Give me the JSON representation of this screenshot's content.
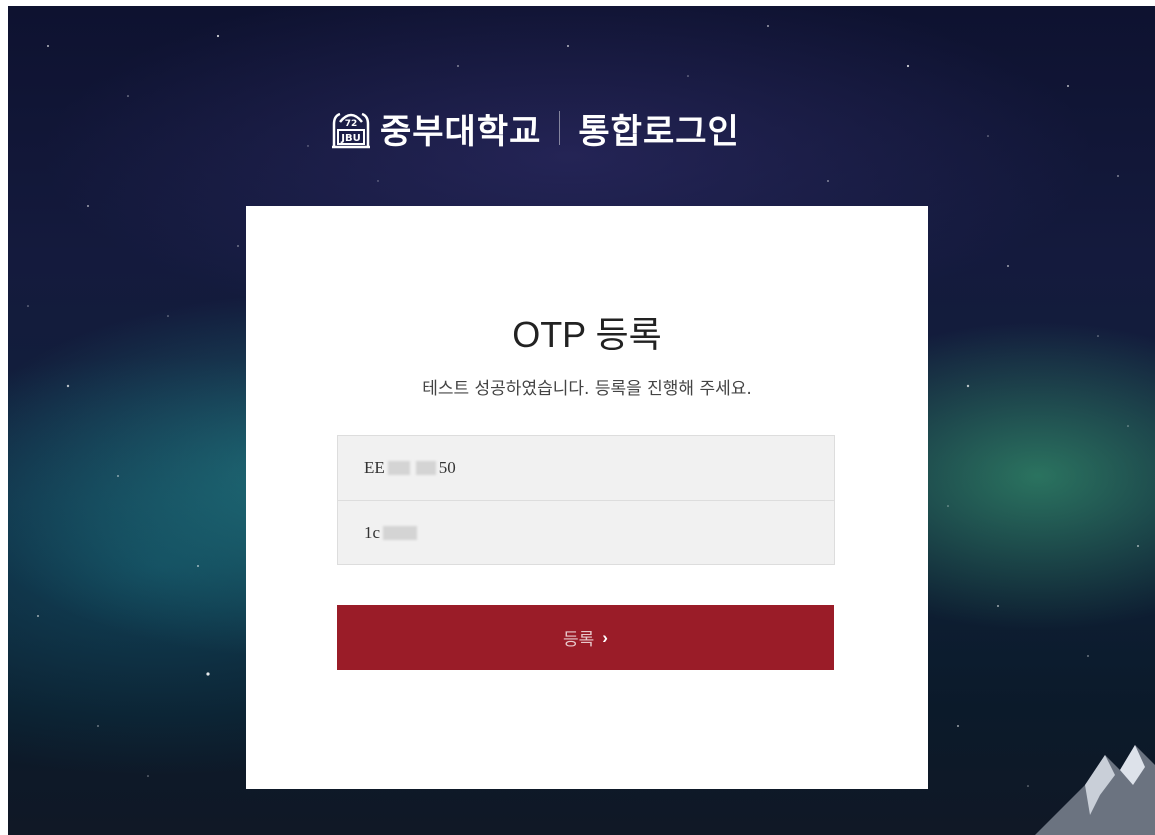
{
  "header": {
    "university_name": "중부대학교",
    "login_title": "통합로그인",
    "logo_icon": "jbu-logo-icon"
  },
  "card": {
    "title": "OTP 등록",
    "subtitle": "테스트 성공하였습니다. 등록을 진행해 주세요.",
    "fields": [
      {
        "visible_start": "EE",
        "visible_end": "50"
      },
      {
        "visible_start": "1c",
        "visible_end": ""
      }
    ],
    "submit_label": "등록",
    "submit_icon": "chevron-right-icon"
  },
  "colors": {
    "button_bg": "#9a1c28",
    "card_bg": "#ffffff",
    "field_bg": "#f1f1f1"
  }
}
